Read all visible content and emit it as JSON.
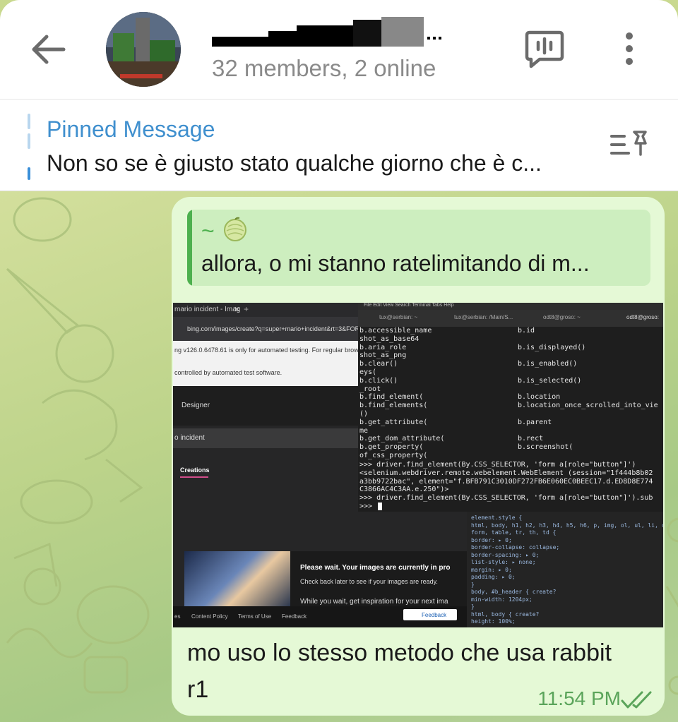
{
  "header": {
    "subtitle": "32 members, 2 online"
  },
  "pinned": {
    "title": "Pinned Message",
    "text": "Non so se è giusto stato qualche giorno che è c..."
  },
  "message": {
    "reply_name": "~",
    "reply_text": "allora, o mi stanno ratelimitando di m...",
    "caption": "mo uso lo stesso metodo che usa rabbit r1",
    "time": "11:54 PM"
  },
  "screenshot": {
    "browser_tab": "mario incident - Imag",
    "url": "bing.com/images/create?q=super+mario+incident&rt=3&FOR",
    "note1": "ng v126.0.6478.61 is only for automated testing. For regular browsin",
    "note2": "controlled by automated test software.",
    "designer": "Designer",
    "incident": "o incident",
    "creations": "Creations",
    "wait_title": "Please wait. Your images are currently in pro",
    "wait_sub": "Check back later to see if your images are ready.",
    "wait_more": "While you wait, get inspiration for your next ima",
    "footer_links": [
      "es",
      "Content Policy",
      "Terms of Use",
      "Feedback"
    ],
    "feedback_btn": "Feedback",
    "term_menu": "File   Edit   View   Search   Terminal   Tabs   Help",
    "term_tabs": [
      "tux@serbian: ~",
      "tux@serbian: /Main/S...",
      "odt8@groso: ~",
      "odt8@groso:"
    ],
    "term_left": [
      "b.accessible_name",
      "shot_as_base64",
      "b.aria_role",
      "shot_as_png",
      "b.clear()",
      "eys(",
      "b.click()",
      "_root",
      "b.find_element(",
      "b.find_elements(",
      "()",
      "b.get_attribute(",
      "me",
      "b.get_dom_attribute(",
      "b.get_property(",
      "of_css_property("
    ],
    "term_right": [
      "b.id",
      "",
      "b.is_displayed()",
      "",
      "b.is_enabled()",
      "",
      "b.is_selected()",
      "",
      "b.location",
      "b.location_once_scrolled_into_vie",
      "",
      "b.parent",
      "",
      "b.rect",
      "b.screenshot(",
      ""
    ],
    "term_tail": [
      ">>> driver.find_element(By.CSS_SELECTOR, 'form a[role=\"button\"]')",
      "<selenium.webdriver.remote.webelement.WebElement (session=\"1f444b8b02",
      "a3bb9722bac\", element=\"f.BFB791C3010DF272FB6E060EC0BEEC17.d.ED8D8E774",
      "C3866AC4C3AA.e.250\")>",
      ">>> driver.find_element(By.CSS_SELECTOR, 'form a[role=\"button\"]').sub",
      ">>> "
    ],
    "dev_lines": [
      "element.style {",
      "html, body, h1, h2, h3, h4, h5, h6, p, img, ol, ul, li,   create?",
      "form, table, tr, th, td {",
      "  border: ▸ 0;",
      "  border-collapse: collapse;",
      "  border-spacing: ▸ 0;",
      "  list-style: ▸ none;",
      "  margin: ▸ 0;",
      "  padding: ▸ 0;",
      "}",
      "body, #b_header {                                    create?",
      "  min-width: 1204px;",
      "}",
      "html, body {                                         create?",
      "  height: 100%;"
    ]
  },
  "colors": {
    "accent": "#3f8fce",
    "bubble": "#e5f9d6",
    "reply_green": "#4db04e",
    "time_green": "#5aa45a"
  }
}
